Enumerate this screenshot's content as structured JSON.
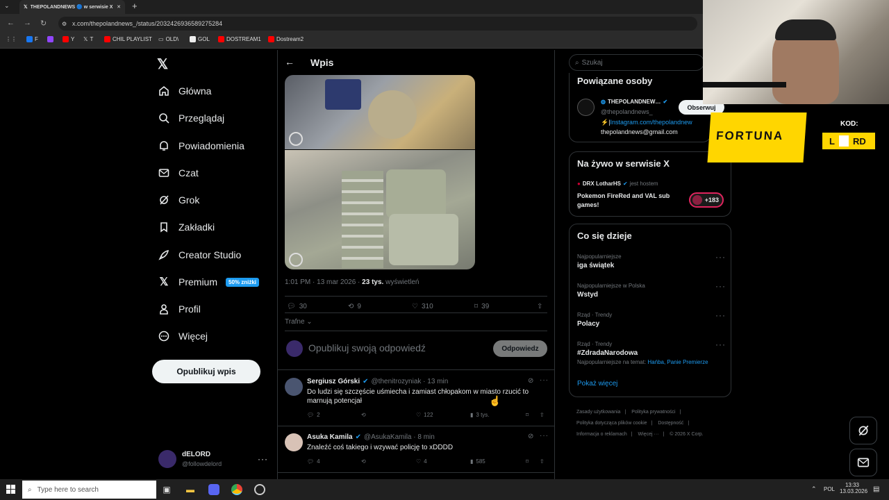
{
  "browser": {
    "tab_title": "THEPOLANDNEWS 🔵 w serwisie X",
    "url": "x.com/thepolandnews_/status/2032426936589275284",
    "bookmarks": [
      "F",
      "Y",
      "T",
      "CHIL PLAYLIST",
      "OLD\\",
      "GOL",
      "DOSTREAM1",
      "Dostream2"
    ]
  },
  "nav": {
    "items": [
      "Główna",
      "Przeglądaj",
      "Powiadomienia",
      "Czat",
      "Grok",
      "Zakładki",
      "Creator Studio",
      "Premium",
      "Profil",
      "Więcej"
    ],
    "premium_badge": "50% zniżki",
    "post_button": "Opublikuj wpis",
    "user_name": "dELORD",
    "user_handle": "@followdelord"
  },
  "header": {
    "title": "Wpis"
  },
  "post": {
    "time": "1:01 PM · 13 mar 2026 · ",
    "views": "23 tys.",
    "views_label": " wyświetleń",
    "replies": "30",
    "reposts": "9",
    "likes": "310",
    "bookmarks": "39",
    "sort": "Trafne"
  },
  "composer": {
    "placeholder": "Opublikuj swoją odpowiedź",
    "button": "Odpowiedz"
  },
  "replies": [
    {
      "name": "Sergiusz Górski",
      "handle": "@thenitrozyniak · 13 min",
      "text1": "Do ludzi się szczęście uśmiecha i zamiast chłopakom w miasto rzucić to",
      "text2": "marnują potencjał",
      "replies": "2",
      "reposts": "",
      "likes": "122",
      "views": "3 tys."
    },
    {
      "name": "Asuka Kamila",
      "handle": "@AsukaKamila · 8 min",
      "text1": "Znaleźć coś takiego i wzywać policję to xDDDD",
      "text2": "",
      "replies": "4",
      "reposts": "",
      "likes": "4",
      "views": "585"
    }
  ],
  "right": {
    "search_placeholder": "Szukaj",
    "related_title": "Powiązane osoby",
    "related_name": "THEPOLANDNEW…",
    "related_handle": "@thepolandnews_",
    "related_link": "Instagram.com/thepolandnew",
    "related_email": "thepolandnews@gmail.com",
    "follow": "Obserwuj",
    "live_title": "Na żywo w serwisie X",
    "live_host": "DRX LotharHS",
    "live_host_suffix": "jest hostem",
    "live_text": "Pokemon FireRed and VAL sub games!",
    "live_count": "+183",
    "trends_title": "Co się dzieje",
    "trends": [
      {
        "context": "Najpopularniejsze",
        "name": "iga świątek",
        "extra": ""
      },
      {
        "context": "Najpopularniejsze w Polska",
        "name": "Wstyd",
        "extra": ""
      },
      {
        "context": "Rząd · Trendy",
        "name": "Polacy",
        "extra": ""
      },
      {
        "context": "Rząd · Trendy",
        "name": "#ZdradaNarodowa",
        "extra": "Najpopularniejsze na temat: "
      }
    ],
    "trend_links": "Hańba, Panie Premierze",
    "show_more": "Pokaż więcej",
    "footer": [
      "Zasady użytkowania",
      "Polityka prywatności",
      "Polityka dotycząca plików cookie",
      "Dostępność",
      "Informacja o reklamach",
      "Więcej ···",
      "© 2026 X Corp."
    ]
  },
  "overlay": {
    "sponsor": "FORTUNA",
    "code_label": "KOD:",
    "code_left": "L",
    "code_right": "RD"
  },
  "taskbar": {
    "search": "Type here to search",
    "lang": "POL",
    "time": "13:33",
    "date": "13.03.2026"
  },
  "colors": {
    "accent": "#1d9bf0",
    "fortuna": "#ffd600",
    "bg": "#000000"
  }
}
